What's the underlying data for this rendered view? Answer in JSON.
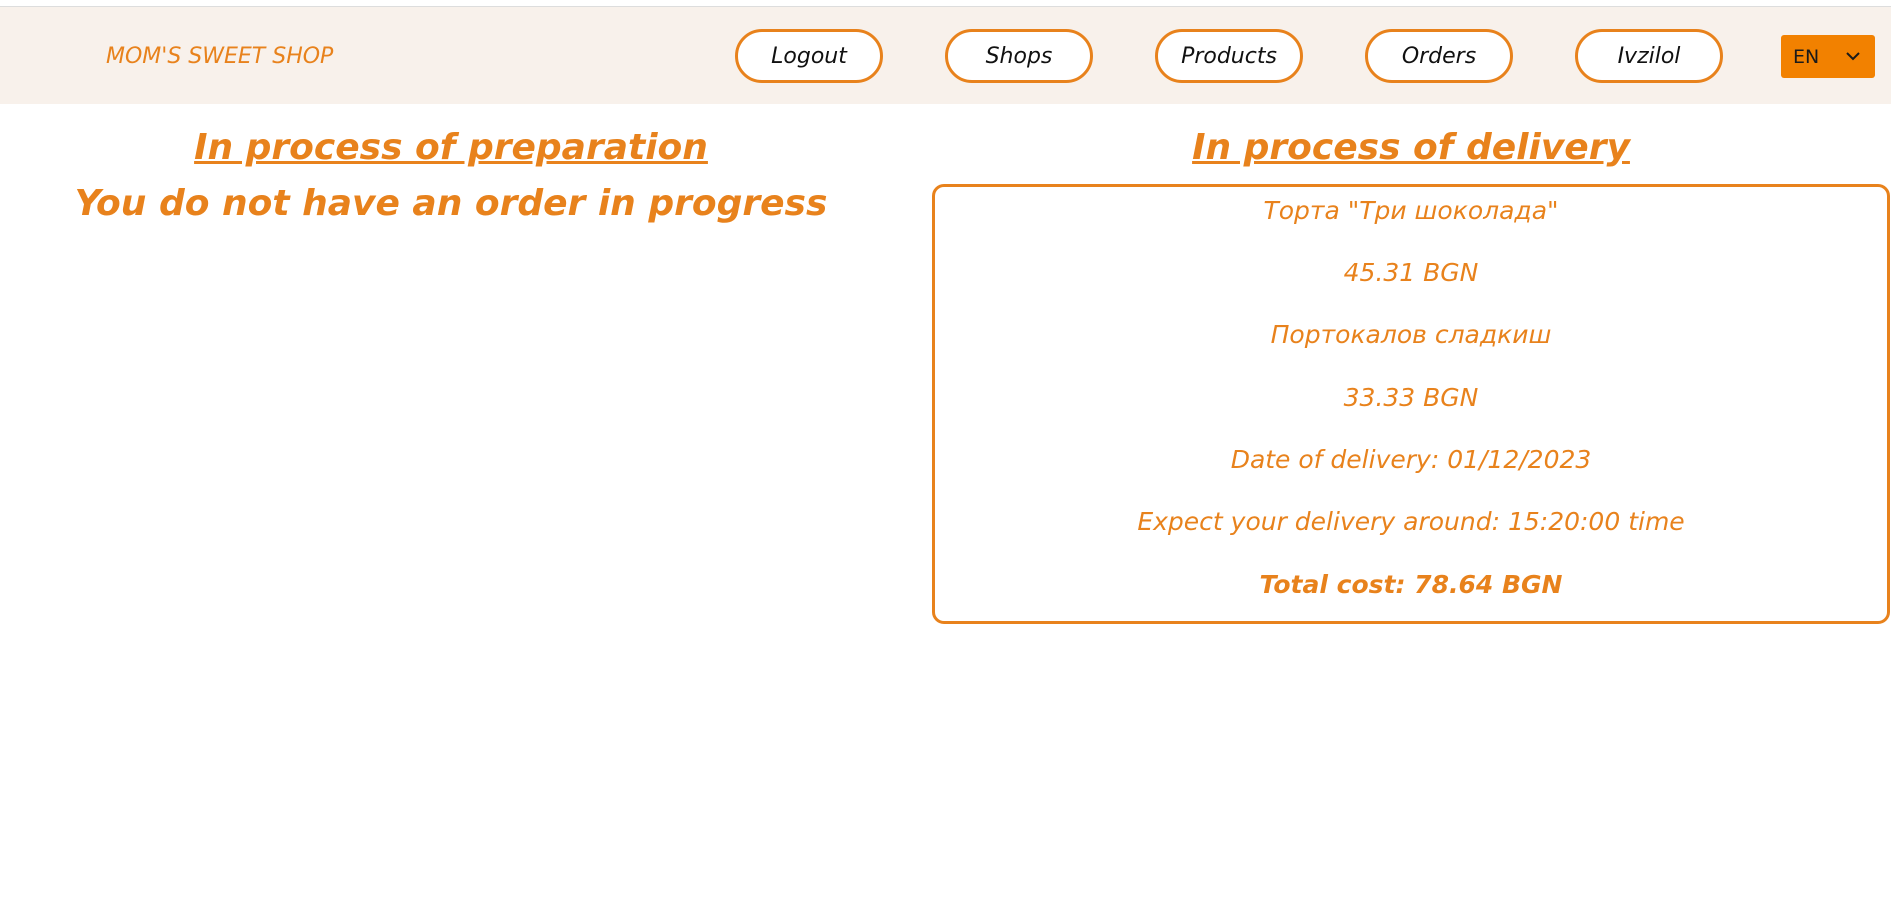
{
  "brand": "MOM'S SWEET SHOP",
  "nav": {
    "logout": "Logout",
    "shops": "Shops",
    "products": "Products",
    "orders": "Orders",
    "user": "Ivzilol"
  },
  "language": {
    "selected": "EN",
    "icon": "chevron-down-icon"
  },
  "preparation": {
    "title": "In process of preparation",
    "empty_message": "You do not have an order in progress"
  },
  "delivery": {
    "title": "In process of delivery",
    "order": {
      "items": [
        {
          "name": "Торта \"Три шоколада\"",
          "price": "45.31 BGN"
        },
        {
          "name": "Портокалов сладкиш",
          "price": "33.33 BGN"
        }
      ],
      "date_of_delivery": "Date of delivery: 01/12/2023",
      "expected_time": "Expect your delivery around: 15:20:00 time",
      "total_cost": "Total cost: 78.64 BGN"
    }
  },
  "colors": {
    "accent": "#e8821c",
    "navbar_bg": "#f8f1eb",
    "lang_bg": "#f28100"
  }
}
